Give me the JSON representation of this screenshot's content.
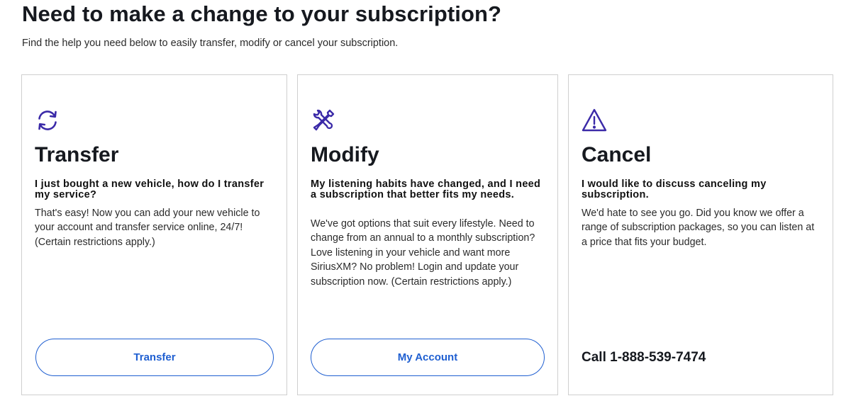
{
  "header": {
    "title": "Need to make a change to your subscription?",
    "subtitle": "Find the help you need below to easily transfer, modify or cancel your subscription."
  },
  "colors": {
    "icon": "#3b2aa8",
    "button_border": "#1f5fd1",
    "button_text": "#1f5fd1",
    "card_border": "#cfcfcf"
  },
  "cards": [
    {
      "icon": "refresh-arrows-icon",
      "title": "Transfer",
      "question": "I just bought a new vehicle, how do I transfer my service?",
      "body": "That's easy! Now you can add your new vehicle to your account and transfer service online, 24/7! (Certain restrictions apply.)",
      "button_label": "Transfer"
    },
    {
      "icon": "wrench-screwdriver-icon",
      "title": "Modify",
      "question": "My listening habits have changed, and I need a subscription that better fits my needs.",
      "body": "We've got options that suit every lifestyle. Need to change from an annual to a monthly subscription? Love listening in your vehicle and want more SiriusXM? No problem! Login and update your subscription now. (Certain restrictions apply.)",
      "button_label": "My Account"
    },
    {
      "icon": "warning-triangle-icon",
      "title": "Cancel",
      "question": "I would like to discuss canceling my subscription.",
      "body": "We'd hate to see you go. Did you know we offer a range of subscription packages, so you can listen at a price that fits your budget.",
      "call_text": "Call 1-888-539-7474"
    }
  ]
}
